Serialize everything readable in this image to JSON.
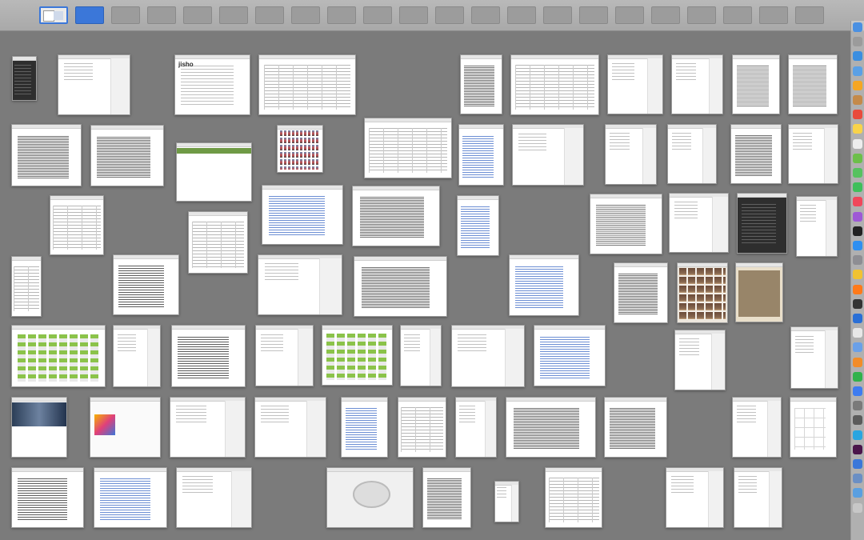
{
  "mission_control": {
    "spaces_count": 22,
    "current_space": 1,
    "selected_space": 2
  },
  "windows": [
    {
      "name": "window-terminal",
      "kind": "dark"
    },
    {
      "name": "window-document-letter",
      "kind": "doc"
    },
    {
      "name": "window-web-jisho",
      "kind": "web",
      "label": "jisho"
    },
    {
      "name": "window-spreadsheet-1",
      "kind": "table"
    },
    {
      "name": "window-text-document-1",
      "kind": "dense"
    },
    {
      "name": "window-text-document-2",
      "kind": "table"
    },
    {
      "name": "window-document-3",
      "kind": "doc"
    },
    {
      "name": "window-document-4",
      "kind": "doc"
    },
    {
      "name": "window-text-document-5",
      "kind": "dense-text"
    },
    {
      "name": "window-text-document-6",
      "kind": "dense-text"
    },
    {
      "name": "window-text-document-7",
      "kind": "dense"
    },
    {
      "name": "window-text-document-8",
      "kind": "dense"
    },
    {
      "name": "window-web-how-to",
      "kind": "web-green"
    },
    {
      "name": "window-app-icons",
      "kind": "icons"
    },
    {
      "name": "window-spreadsheet-2",
      "kind": "table"
    },
    {
      "name": "window-link-document-1",
      "kind": "bluelinks"
    },
    {
      "name": "window-notes-1",
      "kind": "doc"
    },
    {
      "name": "window-document-9",
      "kind": "doc"
    },
    {
      "name": "window-notes-2",
      "kind": "doc"
    },
    {
      "name": "window-text-document-10",
      "kind": "dense"
    },
    {
      "name": "window-document-11",
      "kind": "doc"
    },
    {
      "name": "window-file-list",
      "kind": "table"
    },
    {
      "name": "window-table-2",
      "kind": "table"
    },
    {
      "name": "window-link-document-2",
      "kind": "bluelinks"
    },
    {
      "name": "window-text-document-12",
      "kind": "dense"
    },
    {
      "name": "window-link-document-3",
      "kind": "bluelinks"
    },
    {
      "name": "window-text-document-13",
      "kind": "dense-text"
    },
    {
      "name": "window-document-14",
      "kind": "doc"
    },
    {
      "name": "window-mail-list",
      "kind": "dark"
    },
    {
      "name": "window-document-15",
      "kind": "doc"
    },
    {
      "name": "window-finder-list",
      "kind": "table"
    },
    {
      "name": "window-table-3",
      "kind": "bw"
    },
    {
      "name": "window-document-16",
      "kind": "doc"
    },
    {
      "name": "window-text-document-17",
      "kind": "dense"
    },
    {
      "name": "window-chat",
      "kind": "bluelinks"
    },
    {
      "name": "window-text-document-18",
      "kind": "dense"
    },
    {
      "name": "window-photos",
      "kind": "photos"
    },
    {
      "name": "window-photo-viewer",
      "kind": "sepia"
    },
    {
      "name": "window-web-gallery",
      "kind": "grid"
    },
    {
      "name": "window-document-19",
      "kind": "doc"
    },
    {
      "name": "window-text-document-20",
      "kind": "bw"
    },
    {
      "name": "window-document-21",
      "kind": "doc"
    },
    {
      "name": "window-calendar-grid",
      "kind": "grid"
    },
    {
      "name": "window-document-22",
      "kind": "doc"
    },
    {
      "name": "window-document-23",
      "kind": "doc"
    },
    {
      "name": "window-link-document-4",
      "kind": "bluelinks"
    },
    {
      "name": "window-document-24",
      "kind": "doc"
    },
    {
      "name": "window-document-25",
      "kind": "doc"
    },
    {
      "name": "window-web-photo",
      "kind": "photo-web"
    },
    {
      "name": "window-app-store",
      "kind": "store"
    },
    {
      "name": "window-document-26",
      "kind": "doc"
    },
    {
      "name": "window-document-27",
      "kind": "doc"
    },
    {
      "name": "window-link-document-5",
      "kind": "bluelinks"
    },
    {
      "name": "window-text-document-28",
      "kind": "table"
    },
    {
      "name": "window-document-29",
      "kind": "doc"
    },
    {
      "name": "window-text-document-30",
      "kind": "dense"
    },
    {
      "name": "window-text-document-31",
      "kind": "dense"
    },
    {
      "name": "window-document-32",
      "kind": "doc"
    },
    {
      "name": "window-calendar",
      "kind": "calendar"
    },
    {
      "name": "window-text-document-33",
      "kind": "bw"
    },
    {
      "name": "window-sidebar-notes",
      "kind": "bluelinks"
    },
    {
      "name": "window-document-34",
      "kind": "doc"
    },
    {
      "name": "window-control-panel",
      "kind": "panel"
    },
    {
      "name": "window-text-document-35",
      "kind": "dense"
    },
    {
      "name": "window-document-36",
      "kind": "doc"
    },
    {
      "name": "window-document-37",
      "kind": "table"
    },
    {
      "name": "window-document-38",
      "kind": "doc"
    },
    {
      "name": "window-small-document",
      "kind": "doc"
    }
  ],
  "dock": {
    "icons": [
      "finder-icon",
      "launchpad-icon",
      "safari-icon",
      "mail-icon",
      "photos-icon",
      "contacts-icon",
      "calendar-icon",
      "notes-icon",
      "reminders-icon",
      "maps-icon",
      "messages-icon",
      "facetime-icon",
      "music-icon",
      "podcasts-icon",
      "tv-icon",
      "app-store-icon",
      "system-preferences-icon",
      "chrome-icon",
      "firefox-icon",
      "terminal-icon",
      "xcode-icon",
      "text-edit-icon",
      "preview-icon",
      "pages-icon",
      "numbers-icon",
      "keynote-icon",
      "calculator-icon",
      "activity-monitor-icon",
      "telegram-icon",
      "slack-icon",
      "downloads-icon",
      "documents-icon",
      "applications-icon",
      "trash-icon"
    ],
    "colors": [
      "#4a90e2",
      "#9b9b9b",
      "#3b8ee0",
      "#5aa0e6",
      "#f5a623",
      "#c48a4a",
      "#e94b3c",
      "#f8d34a",
      "#ededed",
      "#6cbf4a",
      "#56c25f",
      "#3fbf5b",
      "#f0475b",
      "#9e59d6",
      "#222222",
      "#2f8ff0",
      "#8e8e93",
      "#f1c232",
      "#ff7a1a",
      "#333333",
      "#2a6fd6",
      "#e7e7e7",
      "#6aa0e8",
      "#f28c28",
      "#30b24b",
      "#3e7cf0",
      "#7a7a7a",
      "#5b5b5b",
      "#2aa5e0",
      "#4a154b",
      "#3b77d9",
      "#6b8fc4",
      "#5a9fe0",
      "#c7c7c7"
    ]
  }
}
